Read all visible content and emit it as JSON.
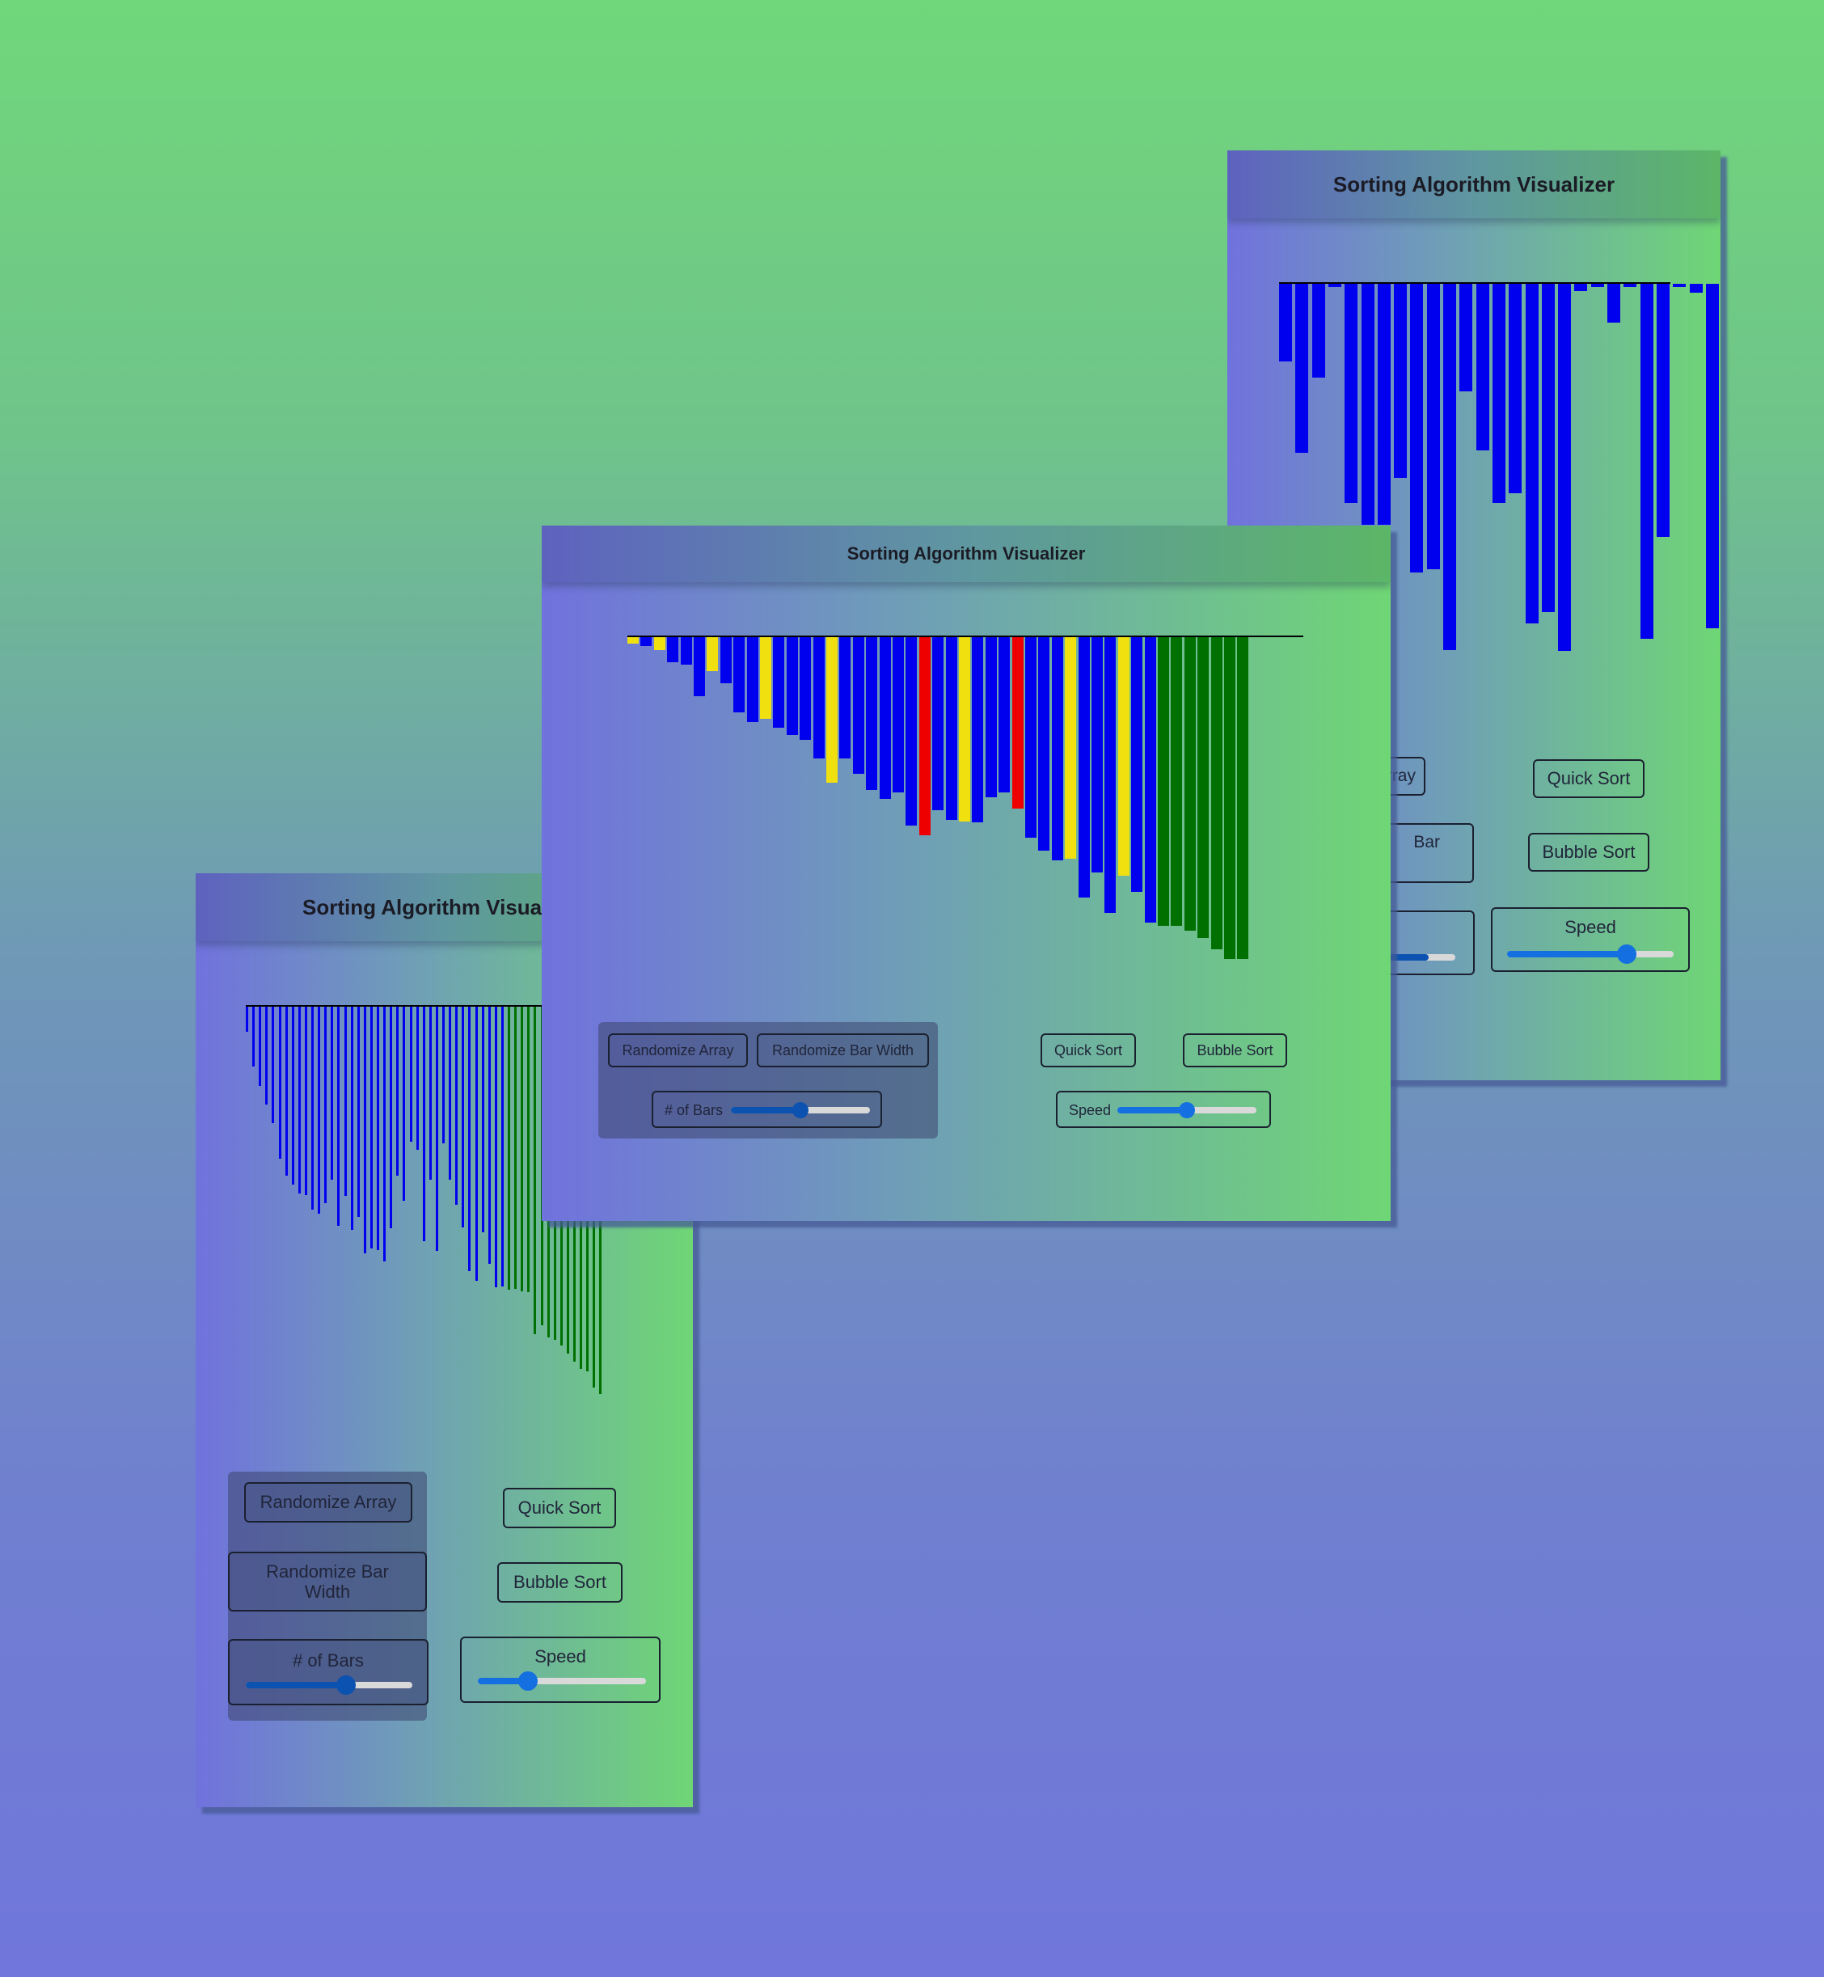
{
  "app": {
    "title": "Sorting Algorithm Visualizer",
    "title_cut": "Sorting Algorithm Visua"
  },
  "controls": {
    "randomize_array": "Randomize Array",
    "randomize_array_cut": "Array",
    "randomize_bar_width": "Randomize Bar Width",
    "randomize_bar_width_cut": "Bar",
    "num_bars_label": "# of Bars",
    "num_bars_cut": "s",
    "quick_sort": "Quick Sort",
    "bubble_sort": "Bubble Sort",
    "speed_label": "Speed"
  },
  "colors": {
    "default": "#0000ee",
    "compare": "#f0e010",
    "swap": "#ee0000",
    "sorted": "#007000"
  },
  "sliders": {
    "back_window": {
      "num_bars": 0.85,
      "speed": 0.72
    },
    "front_window": {
      "num_bars": 0.5,
      "speed": 0.5
    },
    "left_window": {
      "num_bars": 0.6,
      "speed": 0.3
    }
  },
  "arrays": {
    "back_window": {
      "values": [
        62,
        135,
        75,
        0,
        175,
        192,
        192,
        155,
        230,
        228,
        292,
        86,
        133,
        175,
        167,
        271,
        262,
        293,
        6,
        0,
        31,
        0,
        283,
        202,
        0,
        7,
        275
      ],
      "states": [
        "default",
        "default",
        "default",
        "default",
        "default",
        "default",
        "default",
        "default",
        "default",
        "default",
        "default",
        "default",
        "default",
        "default",
        "default",
        "default",
        "default",
        "default",
        "default",
        "default",
        "default",
        "default",
        "default",
        "default",
        "default",
        "default",
        "default"
      ]
    },
    "front_window": {
      "values": [
        5,
        7,
        10,
        20,
        22,
        47,
        27,
        37,
        60,
        68,
        65,
        72,
        78,
        82,
        97,
        116,
        97,
        109,
        122,
        129,
        124,
        150,
        158,
        138,
        146,
        147,
        148,
        128,
        124,
        137,
        160,
        170,
        178,
        177,
        208,
        188,
        220,
        190,
        203,
        228,
        230,
        230,
        234,
        240,
        249,
        257,
        257
      ],
      "states": [
        "compare",
        "default",
        "compare",
        "default",
        "default",
        "default",
        "compare",
        "default",
        "default",
        "default",
        "compare",
        "default",
        "default",
        "default",
        "default",
        "compare",
        "default",
        "default",
        "default",
        "default",
        "default",
        "default",
        "swap",
        "default",
        "default",
        "compare",
        "default",
        "default",
        "default",
        "swap",
        "default",
        "default",
        "default",
        "compare",
        "default",
        "default",
        "default",
        "compare",
        "default",
        "default",
        "sorted",
        "sorted",
        "sorted",
        "sorted",
        "sorted",
        "sorted",
        "sorted"
      ]
    },
    "left_window": {
      "values": [
        20,
        48,
        63,
        78,
        93,
        121,
        135,
        142,
        149,
        150,
        162,
        165,
        157,
        138,
        175,
        151,
        178,
        168,
        197,
        193,
        194,
        203,
        177,
        135,
        155,
        108,
        114,
        187,
        138,
        195,
        109,
        138,
        158,
        176,
        211,
        219,
        180,
        205,
        224,
        223,
        226,
        225,
        227,
        228,
        261,
        254,
        264,
        266,
        270,
        277,
        283,
        289,
        291,
        304,
        309
      ],
      "states": [
        "default",
        "default",
        "default",
        "default",
        "default",
        "default",
        "default",
        "default",
        "default",
        "default",
        "default",
        "default",
        "default",
        "default",
        "default",
        "default",
        "default",
        "default",
        "default",
        "default",
        "default",
        "default",
        "default",
        "default",
        "default",
        "default",
        "default",
        "default",
        "default",
        "default",
        "default",
        "default",
        "default",
        "default",
        "default",
        "default",
        "default",
        "default",
        "default",
        "default",
        "sorted",
        "sorted",
        "sorted",
        "sorted",
        "sorted",
        "sorted",
        "sorted",
        "sorted",
        "sorted",
        "sorted",
        "sorted",
        "sorted",
        "sorted",
        "sorted",
        "sorted"
      ]
    }
  }
}
